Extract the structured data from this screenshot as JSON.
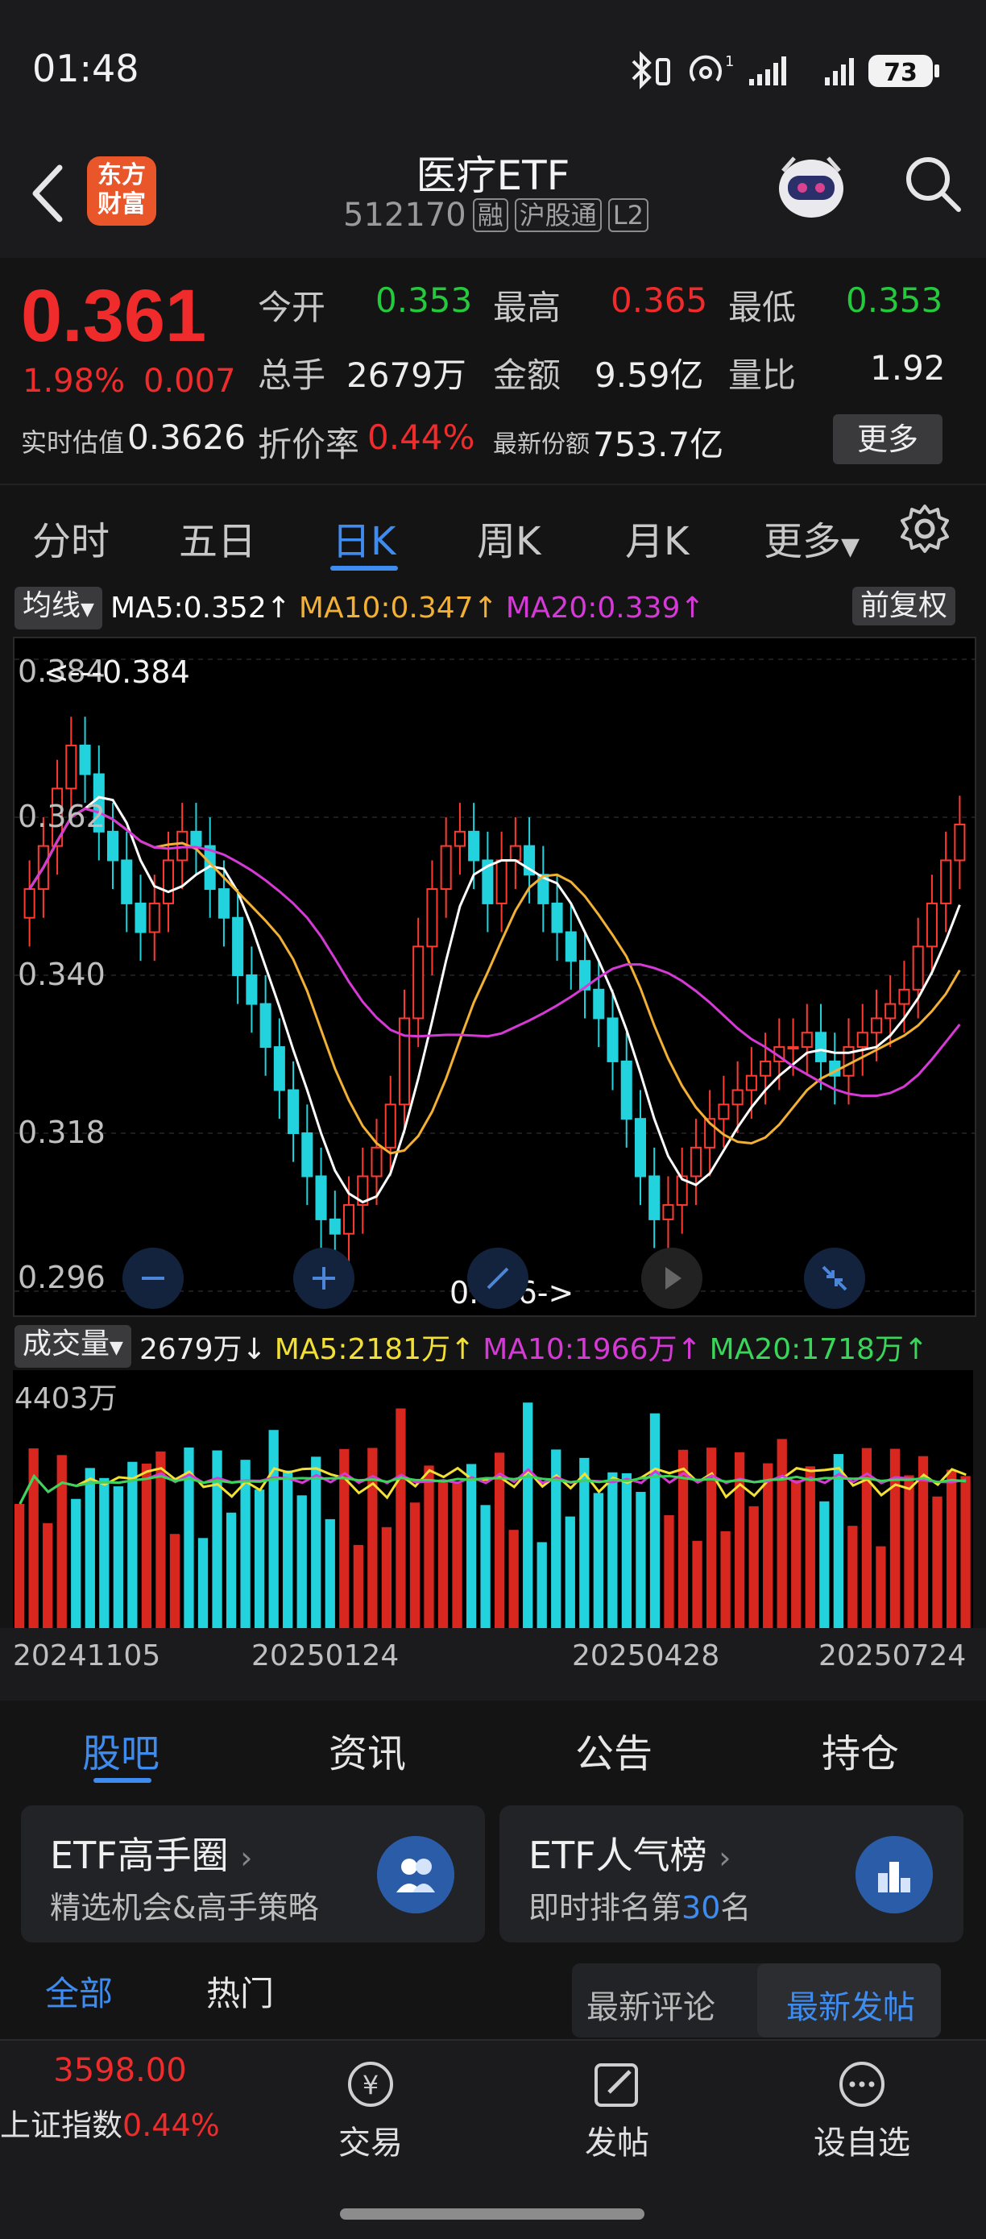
{
  "status": {
    "time": "01:48",
    "signal_label": "1",
    "battery": "73"
  },
  "header": {
    "logo_text_1": "东方",
    "logo_text_2": "财富",
    "title": "医疗ETF",
    "code": "512170",
    "tags": [
      "融",
      "沪股通",
      "L2"
    ]
  },
  "quote": {
    "price": "0.361",
    "change_pct": "1.98%",
    "change": "0.007",
    "open_label": "今开",
    "open": "0.353",
    "high_label": "最高",
    "high": "0.365",
    "low_label": "最低",
    "low": "0.353",
    "volume_label": "总手",
    "volume": "2679万",
    "amount_label": "金额",
    "amount": "9.59亿",
    "ratio_label": "量比",
    "ratio": "1.92",
    "iopv_label": "实时估值",
    "iopv": "0.3626",
    "discount_label": "折价率",
    "discount": "0.44%",
    "shares_label": "最新份额",
    "shares": "753.7亿",
    "more": "更多"
  },
  "ktabs": [
    "分时",
    "五日",
    "日K",
    "周K",
    "月K",
    "更多"
  ],
  "ma": {
    "chip": "均线",
    "ma5": "MA5:0.352↑",
    "ma10": "MA10:0.347↑",
    "ma20": "MA20:0.339↑",
    "adjust": "前复权",
    "colors": {
      "ma5": "#ffffff",
      "ma10": "#f2b134",
      "ma20": "#d63ad6"
    }
  },
  "chart_data": {
    "type": "candlestick",
    "y_ticks": [
      "0.384",
      "0.362",
      "0.340",
      "0.318",
      "0.296"
    ],
    "ylim": [
      0.296,
      0.384
    ],
    "high_marker": "<---0.384",
    "low_marker": "0.296->",
    "closes": [
      0.352,
      0.358,
      0.366,
      0.372,
      0.368,
      0.36,
      0.356,
      0.35,
      0.346,
      0.35,
      0.356,
      0.36,
      0.358,
      0.352,
      0.348,
      0.34,
      0.336,
      0.33,
      0.324,
      0.318,
      0.312,
      0.306,
      0.304,
      0.308,
      0.312,
      0.316,
      0.322,
      0.334,
      0.344,
      0.352,
      0.358,
      0.36,
      0.356,
      0.35,
      0.356,
      0.358,
      0.354,
      0.35,
      0.346,
      0.342,
      0.338,
      0.334,
      0.328,
      0.32,
      0.312,
      0.306,
      0.308,
      0.312,
      0.316,
      0.32,
      0.322,
      0.324,
      0.326,
      0.328,
      0.33,
      0.33,
      0.332,
      0.328,
      0.326,
      0.33,
      0.332,
      0.334,
      0.336,
      0.338,
      0.344,
      0.35,
      0.356,
      0.361
    ]
  },
  "volume": {
    "chip": "成交量",
    "vol": "2679万↓",
    "ma5": "MA5:2181万↑",
    "ma10": "MA10:1966万↑",
    "ma20": "MA20:1718万↑",
    "max_label": "4403万",
    "dates": [
      "20241105",
      "20250124",
      "20250428",
      "20250724"
    ]
  },
  "info_tabs": [
    "股吧",
    "资讯",
    "公告",
    "持仓"
  ],
  "cards": [
    {
      "title": "ETF高手圈",
      "sub": "精选机会&高手策略"
    },
    {
      "title": "ETF人气榜",
      "sub_prefix": "即时排名第",
      "rank": "30",
      "sub_suffix": "名"
    }
  ],
  "filters": {
    "all": "全部",
    "hot": "热门",
    "latest_comment": "最新评论",
    "latest_post": "最新发帖"
  },
  "bottom": {
    "index_value": "3598.00",
    "index_name": "上证指数",
    "index_change": "0.44%",
    "trade": "交易",
    "post": "发帖",
    "watch": "设自选"
  }
}
